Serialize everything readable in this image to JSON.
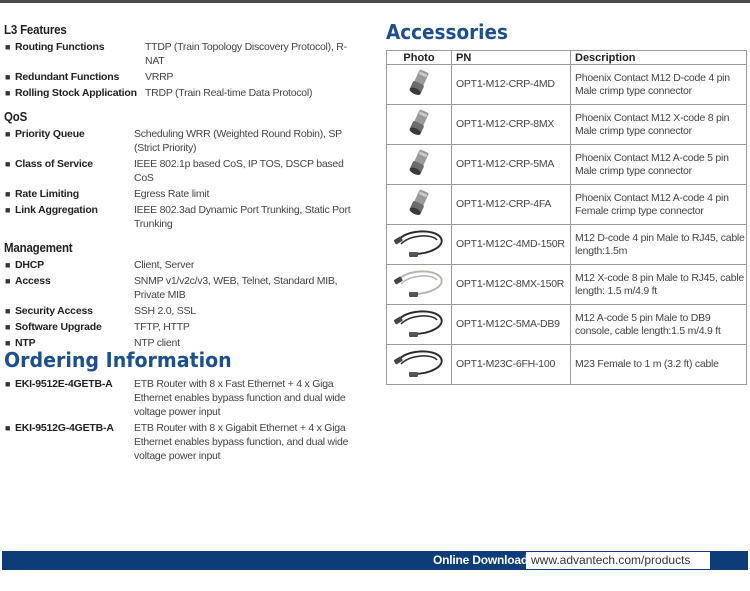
{
  "l3_features": {
    "title": "L3 Features",
    "items": [
      {
        "label": "Routing Functions",
        "value": "TTDP (Train Topology Discovery Protocol), R-NAT"
      },
      {
        "label": "Redundant Functions",
        "value": "VRRP"
      },
      {
        "label": "Rolling Stock Application",
        "value": "TRDP (Train Real-time Data Protocol)"
      }
    ]
  },
  "qos": {
    "title": "QoS",
    "items": [
      {
        "label": "Priority Queue",
        "value": "Scheduling WRR (Weighted Round Robin), SP (Strict Priority)"
      },
      {
        "label": "Class of Service",
        "value": "IEEE 802.1p based CoS, IP TOS, DSCP based CoS"
      },
      {
        "label": "Rate Limiting",
        "value": "Egress Rate limit"
      },
      {
        "label": "Link Aggregation",
        "value": "IEEE 802.3ad Dynamic Port Trunking, Static Port Trunking"
      }
    ]
  },
  "management": {
    "title": "Management",
    "items": [
      {
        "label": "DHCP",
        "value": "Client, Server"
      },
      {
        "label": "Access",
        "value": "SNMP v1/v2c/v3, WEB, Telnet, Standard MIB, Private MIB"
      },
      {
        "label": "Security Access",
        "value": "SSH 2.0, SSL"
      },
      {
        "label": "Software Upgrade",
        "value": "TFTP, HTTP"
      },
      {
        "label": "NTP",
        "value": "NTP client"
      }
    ]
  },
  "ordering": {
    "title": "Ordering Information",
    "items": [
      {
        "label": "EKI-9512E-4GETB-A",
        "value": "ETB Router with 8 x Fast Ethernet + 4 x Giga Ethernet enables bypass function and dual wide voltage power input"
      },
      {
        "label": "EKI-9512G-4GETB-A",
        "value": "ETB Router with 8 x Gigabit Ethernet + 4 x Giga Ethernet enables bypass function, and dual wide voltage power input"
      }
    ]
  },
  "accessories": {
    "title": "Accessories",
    "headers": {
      "photo": "Photo",
      "pn": "PN",
      "description": "Description"
    },
    "rows": [
      {
        "photo": "connector-icon",
        "pn": "OPT1-M12-CRP-4MD",
        "description": "Phoenix Contact M12 D-code 4 pin Male crimp type connector"
      },
      {
        "photo": "connector-icon",
        "pn": "OPT1-M12-CRP-8MX",
        "description": "Phoenix Contact M12 X-code 8 pin Male crimp type connector"
      },
      {
        "photo": "connector-icon",
        "pn": "OPT1-M12-CRP-5MA",
        "description": "Phoenix Contact M12 A-code 5 pin Male crimp type connector"
      },
      {
        "photo": "connector-icon",
        "pn": "OPT1-M12-CRP-4FA",
        "description": "Phoenix Contact M12 A-code 4 pin Female crimp type connector"
      },
      {
        "photo": "cable-icon",
        "pn": "OPT1-M12C-4MD-150R",
        "description": "M12 D-code 4 pin Male to RJ45, cable length:1.5m"
      },
      {
        "photo": "cable-icon",
        "pn": "OPT1-M12C-8MX-150R",
        "description": "M12 X-code 8 pin Male to RJ45, cable length: 1.5 m/4.9 ft"
      },
      {
        "photo": "cable-icon",
        "pn": "OPT1-M12C-5MA-DB9",
        "description": "M12 A-code 5 pin Male to DB9 console, cable length:1.5 m/4.9 ft"
      },
      {
        "photo": "cable-icon",
        "pn": "OPT1-M23C-6FH-100",
        "description": "M23 Female to 1 m (3.2 ft) cable"
      }
    ]
  },
  "footer": {
    "label": "Online Download",
    "url": "www.advantech.com/products"
  },
  "colors": {
    "heading_blue": "#1d4f8c",
    "footer_blue": "#0c3d78"
  }
}
